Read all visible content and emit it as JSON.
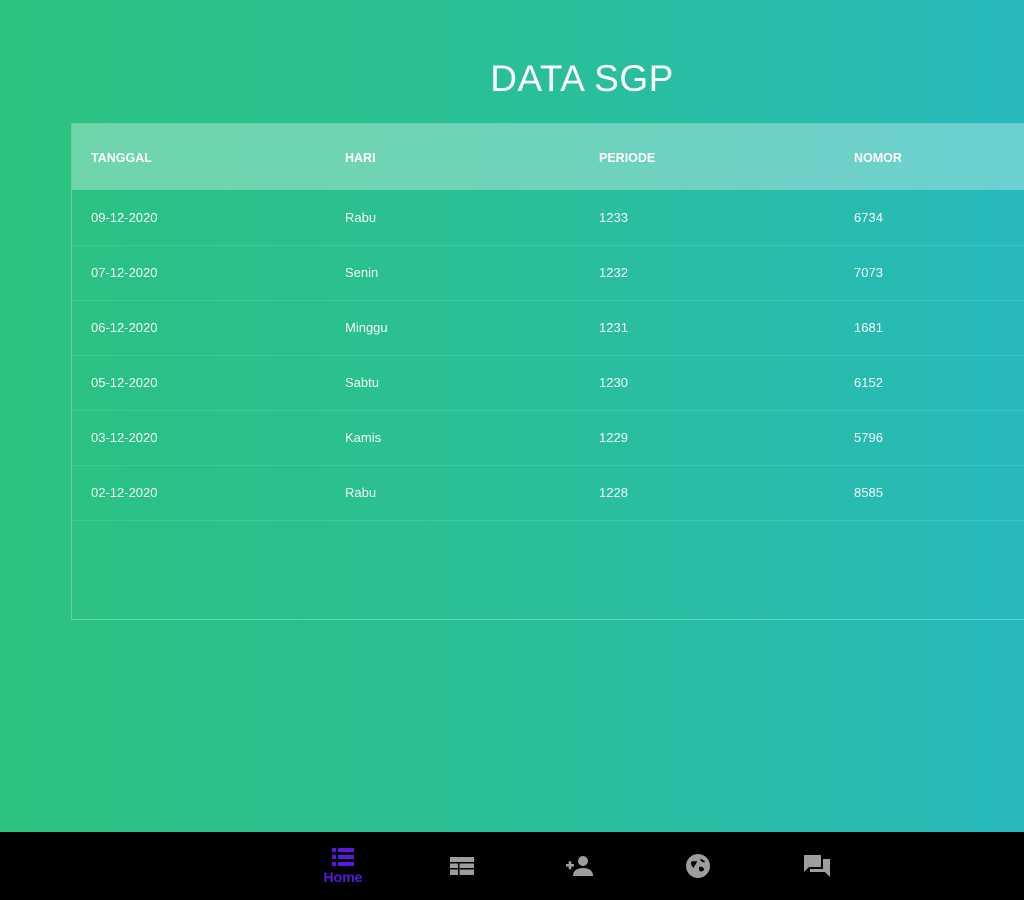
{
  "page": {
    "title": "DATA SGP"
  },
  "table": {
    "columns": [
      "TANGGAL",
      "HARI",
      "PERIODE",
      "NOMOR"
    ],
    "rows": [
      [
        "09-12-2020",
        "Rabu",
        "1233",
        "6734"
      ],
      [
        "07-12-2020",
        "Senin",
        "1232",
        "7073"
      ],
      [
        "06-12-2020",
        "Minggu",
        "1231",
        "1681"
      ],
      [
        "05-12-2020",
        "Sabtu",
        "1230",
        "6152"
      ],
      [
        "03-12-2020",
        "Kamis",
        "1229",
        "5796"
      ],
      [
        "02-12-2020",
        "Rabu",
        "1228",
        "8585"
      ]
    ]
  },
  "bottom_nav": {
    "accent_color": "#5b18e0",
    "inactive_color": "#9e9e9e",
    "items": [
      {
        "icon": "list-icon",
        "label": "Home",
        "active": true
      },
      {
        "icon": "table-icon",
        "label": "",
        "active": false
      },
      {
        "icon": "person-add-icon",
        "label": "",
        "active": false
      },
      {
        "icon": "globe-icon",
        "label": "",
        "active": false
      },
      {
        "icon": "chat-icon",
        "label": "",
        "active": false
      }
    ]
  }
}
